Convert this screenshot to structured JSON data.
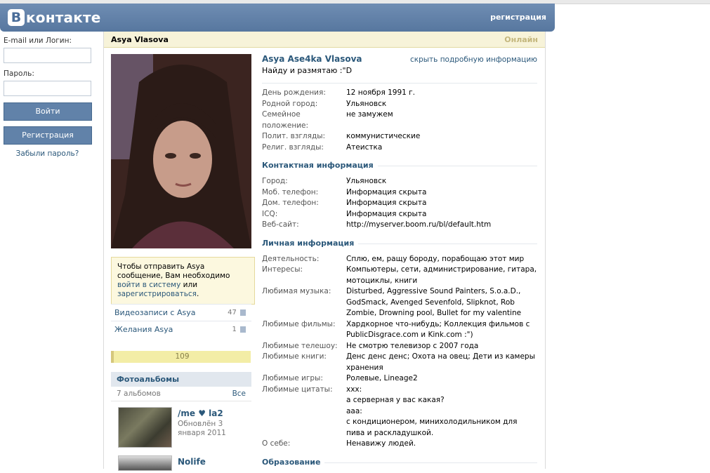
{
  "header": {
    "logo_letter": "В",
    "logo_text": "контакте",
    "register_link": "регистрация"
  },
  "login": {
    "email_label": "E-mail или Логин:",
    "email_value": "",
    "password_label": "Пароль:",
    "password_value": "",
    "login_button": "Войти",
    "register_button": "Регистрация",
    "forgot_link": "Забыли пароль?"
  },
  "profile": {
    "title_name": "Asya Vlasova",
    "online_status": "Онлайн",
    "full_name": "Asya Ase4ka Vlasova",
    "hide_info_link": "скрыть подробную информацию",
    "status_text": "Найду и размятаю :\"D",
    "basic": [
      {
        "key": "День рождения:",
        "value": "12 ноября 1991 г."
      },
      {
        "key": "Родной город:",
        "value": "Ульяновск"
      },
      {
        "key": "Семейное положение:",
        "value": "не замужем"
      },
      {
        "key": "Полит. взгляды:",
        "value": "коммунистические"
      },
      {
        "key": "Религ. взгляды:",
        "value": "Атеистка"
      }
    ],
    "contact_title": "Контактная информация",
    "contact": [
      {
        "key": "Город:",
        "value": "Ульяновск"
      },
      {
        "key": "Моб. телефон:",
        "value": "Информация скрыта"
      },
      {
        "key": "Дом. телефон:",
        "value": "Информация скрыта"
      },
      {
        "key": "ICQ:",
        "value": "Информация скрыта"
      },
      {
        "key": "Веб-сайт:",
        "value": "http://myserver.boom.ru/bl/default.htm"
      }
    ],
    "personal_title": "Личная информация",
    "personal": [
      {
        "key": "Деятельность:",
        "value": "Сплю, ем, ращу бороду, порабощаю этот мир"
      },
      {
        "key": "Интересы:",
        "value": "Компьютеры, сети, администрирование, гитара, мотоциклы, книги"
      },
      {
        "key": "Любимая музыка:",
        "value": "Disturbed, Aggressive Sound Painters, S.o.a.D., GodSmack, Avenged Sevenfold, Slipknot, Rob Zombie, Drowning pool, Bullet for my valentine"
      },
      {
        "key": "Любимые фильмы:",
        "value": "Хардкорное что-нибудь; Коллекция фильмов с PublicDisgrace.com и Kink.com :\")"
      },
      {
        "key": "Любимые телешоу:",
        "value": "Не смотрю телевизор с 2007 года"
      },
      {
        "key": "Любимые книги:",
        "value": "Денс денс денс; Охота на овец; Дети из камеры хранения"
      },
      {
        "key": "Любимые игры:",
        "value": "Ролевые, Lineage2"
      },
      {
        "key": "Любимые цитаты:",
        "value": "xxx:\nа серверная у вас какая?\naaa:\nс кондиционером, минихолодильником для пива и раскладушкой."
      },
      {
        "key": "О себе:",
        "value": "Ненавижу людей."
      }
    ],
    "education_title": "Образование"
  },
  "message_box": {
    "text1": "Чтобы отправить Asya сообщение, Вам необходимо ",
    "login_link": "войти в систему",
    "text2": " или ",
    "register_link": "зарегистрироваться",
    "text3": "."
  },
  "side_links": [
    {
      "label": "Видеозаписи с Asya",
      "count": "47"
    },
    {
      "label": "Желания Asya",
      "count": "1"
    }
  ],
  "rating": "109",
  "albums": {
    "title": "Фотоальбомы",
    "count_text": "7 альбомов",
    "all_link": "Все",
    "items": [
      {
        "title": "/me ♥ la2",
        "updated": "Обновлён 3 января 2011"
      },
      {
        "title": "Nolife",
        "updated": ""
      }
    ]
  }
}
